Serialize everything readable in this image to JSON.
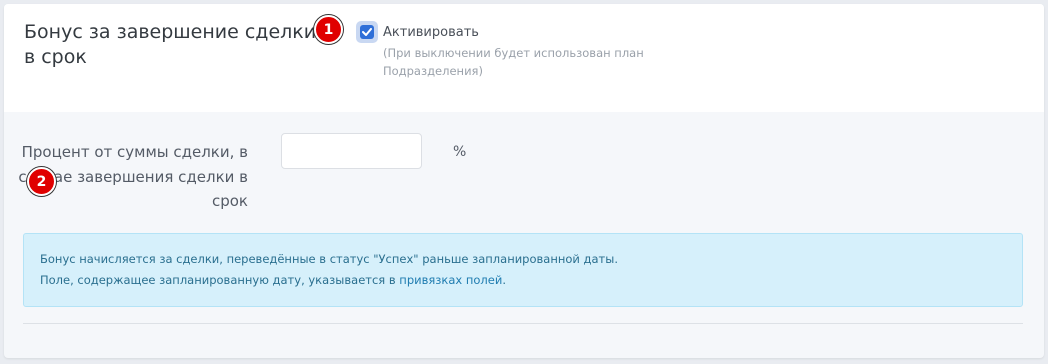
{
  "section": {
    "title": "Бонус за завершение сделки в срок"
  },
  "markers": {
    "one": "1",
    "two": "2",
    "color": "#e00000"
  },
  "activate": {
    "label": "Активировать",
    "checked": true,
    "hint": "(При выключении будет использован план Подразделения)"
  },
  "percent_field": {
    "label": "Процент от суммы сделки, в случае завершения сделки в срок",
    "value": "",
    "unit": "%"
  },
  "info": {
    "line1": "Бонус начисляется за сделки, переведённые в статус \"Успех\" раньше запланированной даты.",
    "line2_prefix": "Поле, содержащее запланированную дату, указывается в ",
    "line2_link": "привязках полей",
    "line2_suffix": "."
  },
  "colors": {
    "accent": "#2f6fd8",
    "info_bg": "#d6f0fb",
    "info_text": "#2a6f8f"
  },
  "icons": {
    "checkbox": "checkmark-icon"
  }
}
